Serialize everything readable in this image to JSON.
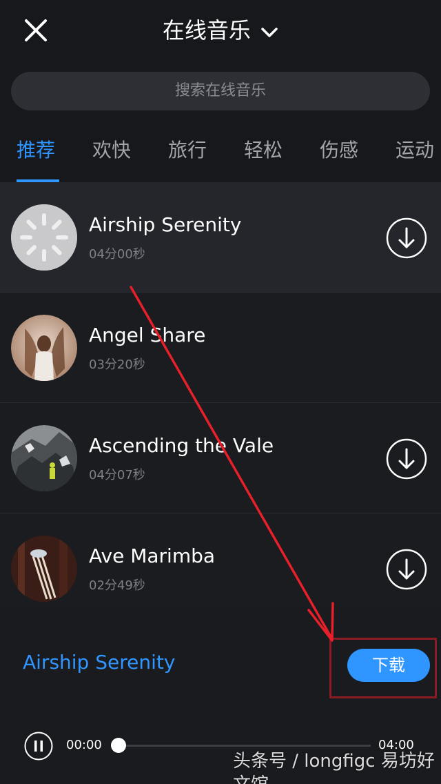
{
  "header": {
    "title": "在线音乐",
    "close_icon": "close-icon",
    "dropdown_icon": "chevron-down-icon"
  },
  "search": {
    "placeholder": "搜索在线音乐"
  },
  "tabs": [
    {
      "label": "推荐",
      "active": true
    },
    {
      "label": "欢快",
      "active": false
    },
    {
      "label": "旅行",
      "active": false
    },
    {
      "label": "轻松",
      "active": false
    },
    {
      "label": "伤感",
      "active": false
    },
    {
      "label": "运动",
      "active": false
    }
  ],
  "songs": [
    {
      "title": "Airship Serenity",
      "duration": "04分00秒",
      "state": "loading",
      "download_icon": "download-icon"
    },
    {
      "title": "Angel Share",
      "duration": "03分20秒",
      "state": "playing",
      "download_icon": ""
    },
    {
      "title": "Ascending the Vale",
      "duration": "04分07秒",
      "state": "idle",
      "download_icon": "download-icon"
    },
    {
      "title": "Ave Marimba",
      "duration": "02分49秒",
      "state": "idle",
      "download_icon": "download-icon"
    }
  ],
  "player": {
    "now_playing": "Airship Serenity",
    "download_label": "下载",
    "current_time": "00:00",
    "total_time": "04:00",
    "progress": 0,
    "play_icon": "pause-icon"
  },
  "watermark": "头条号 / longfigc 易坊好文馆",
  "colors": {
    "accent": "#2f95ff",
    "background": "#17181c",
    "highlight": "#8b1b25",
    "annotation_arrow": "#e8202a"
  }
}
